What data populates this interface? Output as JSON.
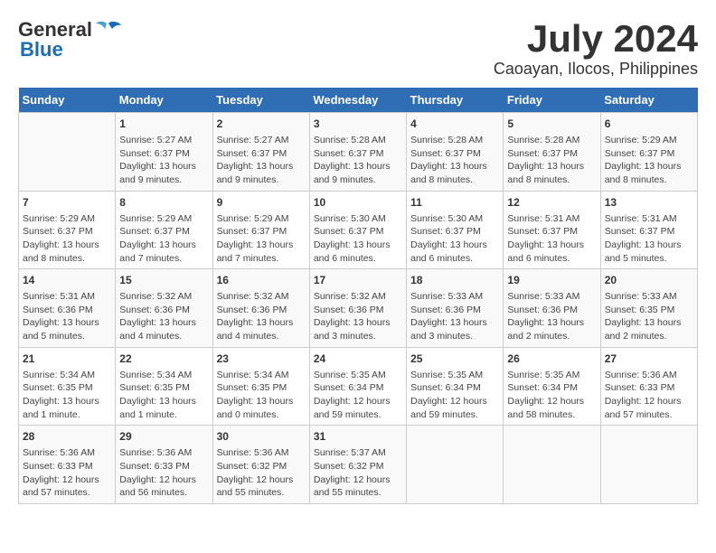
{
  "logo": {
    "general": "General",
    "blue": "Blue"
  },
  "title": "July 2024",
  "subtitle": "Caoayan, Ilocos, Philippines",
  "days_of_week": [
    "Sunday",
    "Monday",
    "Tuesday",
    "Wednesday",
    "Thursday",
    "Friday",
    "Saturday"
  ],
  "weeks": [
    [
      {
        "day": "",
        "info": ""
      },
      {
        "day": "1",
        "info": "Sunrise: 5:27 AM\nSunset: 6:37 PM\nDaylight: 13 hours\nand 9 minutes."
      },
      {
        "day": "2",
        "info": "Sunrise: 5:27 AM\nSunset: 6:37 PM\nDaylight: 13 hours\nand 9 minutes."
      },
      {
        "day": "3",
        "info": "Sunrise: 5:28 AM\nSunset: 6:37 PM\nDaylight: 13 hours\nand 9 minutes."
      },
      {
        "day": "4",
        "info": "Sunrise: 5:28 AM\nSunset: 6:37 PM\nDaylight: 13 hours\nand 8 minutes."
      },
      {
        "day": "5",
        "info": "Sunrise: 5:28 AM\nSunset: 6:37 PM\nDaylight: 13 hours\nand 8 minutes."
      },
      {
        "day": "6",
        "info": "Sunrise: 5:29 AM\nSunset: 6:37 PM\nDaylight: 13 hours\nand 8 minutes."
      }
    ],
    [
      {
        "day": "7",
        "info": "Sunrise: 5:29 AM\nSunset: 6:37 PM\nDaylight: 13 hours\nand 8 minutes."
      },
      {
        "day": "8",
        "info": "Sunrise: 5:29 AM\nSunset: 6:37 PM\nDaylight: 13 hours\nand 7 minutes."
      },
      {
        "day": "9",
        "info": "Sunrise: 5:29 AM\nSunset: 6:37 PM\nDaylight: 13 hours\nand 7 minutes."
      },
      {
        "day": "10",
        "info": "Sunrise: 5:30 AM\nSunset: 6:37 PM\nDaylight: 13 hours\nand 6 minutes."
      },
      {
        "day": "11",
        "info": "Sunrise: 5:30 AM\nSunset: 6:37 PM\nDaylight: 13 hours\nand 6 minutes."
      },
      {
        "day": "12",
        "info": "Sunrise: 5:31 AM\nSunset: 6:37 PM\nDaylight: 13 hours\nand 6 minutes."
      },
      {
        "day": "13",
        "info": "Sunrise: 5:31 AM\nSunset: 6:37 PM\nDaylight: 13 hours\nand 5 minutes."
      }
    ],
    [
      {
        "day": "14",
        "info": "Sunrise: 5:31 AM\nSunset: 6:36 PM\nDaylight: 13 hours\nand 5 minutes."
      },
      {
        "day": "15",
        "info": "Sunrise: 5:32 AM\nSunset: 6:36 PM\nDaylight: 13 hours\nand 4 minutes."
      },
      {
        "day": "16",
        "info": "Sunrise: 5:32 AM\nSunset: 6:36 PM\nDaylight: 13 hours\nand 4 minutes."
      },
      {
        "day": "17",
        "info": "Sunrise: 5:32 AM\nSunset: 6:36 PM\nDaylight: 13 hours\nand 3 minutes."
      },
      {
        "day": "18",
        "info": "Sunrise: 5:33 AM\nSunset: 6:36 PM\nDaylight: 13 hours\nand 3 minutes."
      },
      {
        "day": "19",
        "info": "Sunrise: 5:33 AM\nSunset: 6:36 PM\nDaylight: 13 hours\nand 2 minutes."
      },
      {
        "day": "20",
        "info": "Sunrise: 5:33 AM\nSunset: 6:35 PM\nDaylight: 13 hours\nand 2 minutes."
      }
    ],
    [
      {
        "day": "21",
        "info": "Sunrise: 5:34 AM\nSunset: 6:35 PM\nDaylight: 13 hours\nand 1 minute."
      },
      {
        "day": "22",
        "info": "Sunrise: 5:34 AM\nSunset: 6:35 PM\nDaylight: 13 hours\nand 1 minute."
      },
      {
        "day": "23",
        "info": "Sunrise: 5:34 AM\nSunset: 6:35 PM\nDaylight: 13 hours\nand 0 minutes."
      },
      {
        "day": "24",
        "info": "Sunrise: 5:35 AM\nSunset: 6:34 PM\nDaylight: 12 hours\nand 59 minutes."
      },
      {
        "day": "25",
        "info": "Sunrise: 5:35 AM\nSunset: 6:34 PM\nDaylight: 12 hours\nand 59 minutes."
      },
      {
        "day": "26",
        "info": "Sunrise: 5:35 AM\nSunset: 6:34 PM\nDaylight: 12 hours\nand 58 minutes."
      },
      {
        "day": "27",
        "info": "Sunrise: 5:36 AM\nSunset: 6:33 PM\nDaylight: 12 hours\nand 57 minutes."
      }
    ],
    [
      {
        "day": "28",
        "info": "Sunrise: 5:36 AM\nSunset: 6:33 PM\nDaylight: 12 hours\nand 57 minutes."
      },
      {
        "day": "29",
        "info": "Sunrise: 5:36 AM\nSunset: 6:33 PM\nDaylight: 12 hours\nand 56 minutes."
      },
      {
        "day": "30",
        "info": "Sunrise: 5:36 AM\nSunset: 6:32 PM\nDaylight: 12 hours\nand 55 minutes."
      },
      {
        "day": "31",
        "info": "Sunrise: 5:37 AM\nSunset: 6:32 PM\nDaylight: 12 hours\nand 55 minutes."
      },
      {
        "day": "",
        "info": ""
      },
      {
        "day": "",
        "info": ""
      },
      {
        "day": "",
        "info": ""
      }
    ]
  ]
}
